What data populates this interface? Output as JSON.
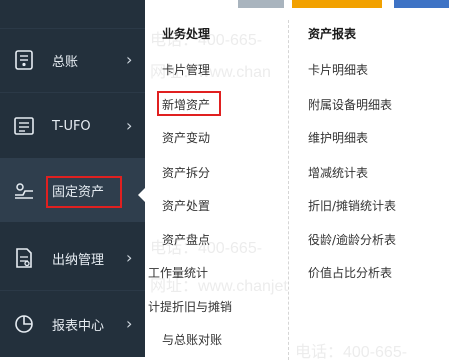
{
  "sidebar": {
    "items": [
      {
        "label": "总账",
        "icon": "ledger-icon"
      },
      {
        "label": "T-UFO",
        "icon": "report-sheet-icon"
      },
      {
        "label": "固定资产",
        "icon": "fixed-asset-icon"
      },
      {
        "label": "出纳管理",
        "icon": "cashier-doc-icon"
      },
      {
        "label": "报表中心",
        "icon": "pie-chart-icon"
      }
    ],
    "active_index": 2
  },
  "dropdown": {
    "col1_title": "业务处理",
    "col1_items": [
      "卡片管理",
      "新增资产",
      "资产变动",
      "资产拆分",
      "资产处置",
      "资产盘点",
      "工作量统计",
      "计提折旧与摊销",
      "与总账对账"
    ],
    "col2_title": "资产报表",
    "col2_items": [
      "卡片明细表",
      "附属设备明细表",
      "维护明细表",
      "增减统计表",
      "折旧/摊销统计表",
      "役龄/逾龄分析表",
      "价值占比分析表"
    ],
    "highlighted": "新增资产"
  },
  "watermarks": [
    "电话：400-665-",
    "网址：www.chan",
    "电话：400-665-",
    "网址：www.chanjet",
    "电话：400-665-"
  ],
  "colors": {
    "sidebar_bg": "#23303c",
    "highlight_border": "#e02020"
  }
}
